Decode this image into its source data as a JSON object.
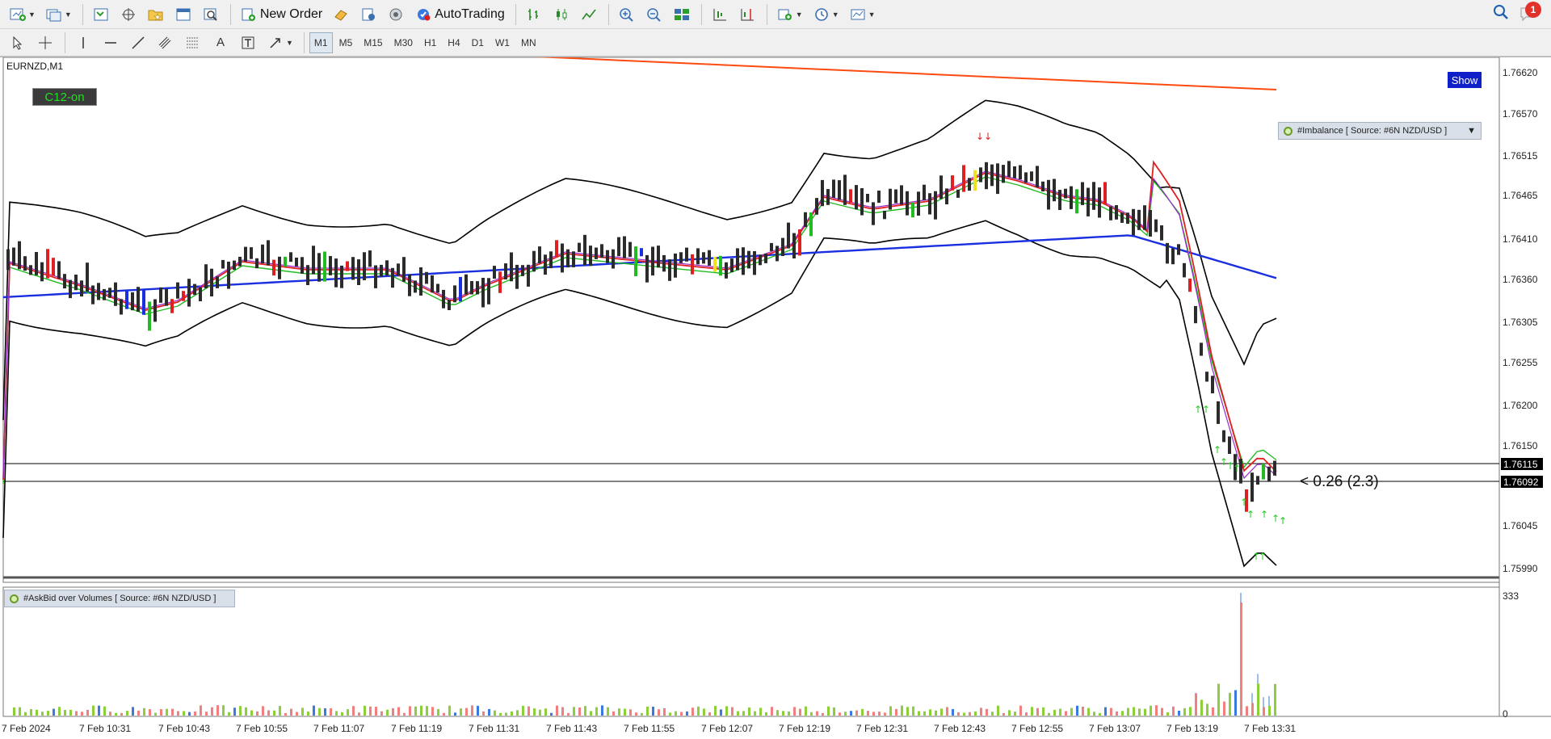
{
  "toolbar": {
    "new_order_label": "New Order",
    "autotrading_label": "AutoTrading",
    "notification_count": "1",
    "timeframes": [
      "M1",
      "M5",
      "M15",
      "M30",
      "H1",
      "H4",
      "D1",
      "W1",
      "MN"
    ],
    "active_timeframe": "M1"
  },
  "chart": {
    "symbol_label": "EURNZD,M1",
    "c12_label": "C12-on",
    "show_label": "Show",
    "imbalance_label": "#Imbalance [ Source: #6N NZD/USD ]",
    "askbid_label": "#AskBid over Volumes [ Source: #6N NZD/USD ]",
    "spread_label": "< 0.26 (2.3)",
    "price_axis": [
      "1.76620",
      "1.76570",
      "1.76515",
      "1.76465",
      "1.76410",
      "1.76360",
      "1.76305",
      "1.76255",
      "1.76200",
      "1.76150",
      "1.76045",
      "1.75990"
    ],
    "bid_price": "1.76115",
    "ask_price": "1.76092",
    "volume_axis": [
      "333",
      "0"
    ],
    "time_axis": [
      "7 Feb 2024",
      "7 Feb 10:31",
      "7 Feb 10:43",
      "7 Feb 10:55",
      "7 Feb 11:07",
      "7 Feb 11:19",
      "7 Feb 11:31",
      "7 Feb 11:43",
      "7 Feb 11:55",
      "7 Feb 12:07",
      "7 Feb 12:19",
      "7 Feb 12:31",
      "7 Feb 12:43",
      "7 Feb 12:55",
      "7 Feb 13:07",
      "7 Feb 13:19",
      "7 Feb 13:31"
    ],
    "colors": {
      "bull_bar": "#2b2b2b",
      "bear_bar": "#2b2b2b",
      "up_signal": "#22cc22",
      "down_signal": "#e02020",
      "ma_blue": "#1a2fe0",
      "ma_red": "#e02020",
      "ma_green": "#22bb22",
      "ma_purple": "#9a2ad0",
      "bands": "#000000",
      "long_ma": "#ff4a10",
      "vol_green": "#8ccf3a",
      "vol_red": "#f08080",
      "vol_blue": "#3a7ae0"
    }
  }
}
